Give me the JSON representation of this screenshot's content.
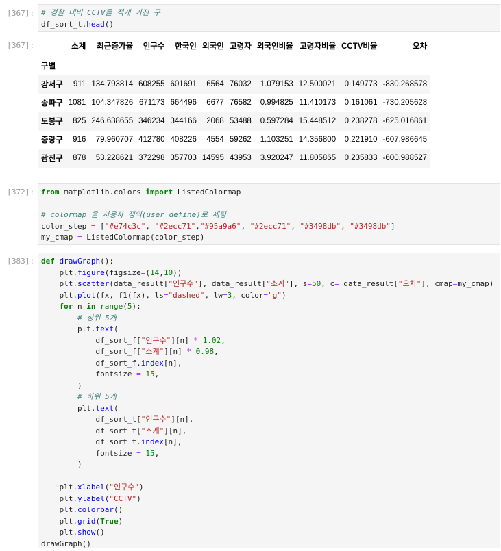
{
  "cells": [
    {
      "prompt": "[367]:",
      "lines": [
        [
          {
            "t": "# 경찰 대비 CCTV를 적게 가진 구",
            "c": "cm"
          }
        ],
        [
          {
            "t": "df_sort_t."
          },
          {
            "t": "head",
            "c": "fn"
          },
          {
            "t": "()"
          }
        ]
      ]
    },
    {
      "prompt": "[372]:",
      "lines": [
        [
          {
            "t": "from",
            "c": "kw"
          },
          {
            "t": " matplotlib.colors "
          },
          {
            "t": "import",
            "c": "kw"
          },
          {
            "t": " ListedColormap"
          }
        ],
        [
          {
            "t": ""
          }
        ],
        [
          {
            "t": "# colormap 을 사용자 정의(user define)로 세팅",
            "c": "cm"
          }
        ],
        [
          {
            "t": "color_step "
          },
          {
            "t": "=",
            "c": "op"
          },
          {
            "t": " ["
          },
          {
            "t": "\"#e74c3c\"",
            "c": "st"
          },
          {
            "t": ", "
          },
          {
            "t": "\"#2ecc71\"",
            "c": "st"
          },
          {
            "t": ","
          },
          {
            "t": "\"#95a9a6\"",
            "c": "st"
          },
          {
            "t": ", "
          },
          {
            "t": "\"#2ecc71\"",
            "c": "st"
          },
          {
            "t": ", "
          },
          {
            "t": "\"#3498db\"",
            "c": "st"
          },
          {
            "t": ", "
          },
          {
            "t": "\"#3498db\"",
            "c": "st"
          },
          {
            "t": "]"
          }
        ],
        [
          {
            "t": "my_cmap "
          },
          {
            "t": "=",
            "c": "op"
          },
          {
            "t": " ListedColormap(color_step)"
          }
        ]
      ]
    },
    {
      "prompt": "[383]:",
      "lines": [
        [
          {
            "t": "def",
            "c": "kw"
          },
          {
            "t": " "
          },
          {
            "t": "drawGraph",
            "c": "fn"
          },
          {
            "t": "():"
          }
        ],
        [
          {
            "t": "    plt."
          },
          {
            "t": "figure",
            "c": "fn"
          },
          {
            "t": "(figsize"
          },
          {
            "t": "=",
            "c": "op"
          },
          {
            "t": "("
          },
          {
            "t": "14",
            "c": "nm"
          },
          {
            "t": ","
          },
          {
            "t": "10",
            "c": "nm"
          },
          {
            "t": "))"
          }
        ],
        [
          {
            "t": "    plt."
          },
          {
            "t": "scatter",
            "c": "fn"
          },
          {
            "t": "(data_result["
          },
          {
            "t": "\"인구수\"",
            "c": "st"
          },
          {
            "t": "], data_result["
          },
          {
            "t": "\"소계\"",
            "c": "st"
          },
          {
            "t": "], s"
          },
          {
            "t": "=",
            "c": "op"
          },
          {
            "t": "50",
            "c": "nm"
          },
          {
            "t": ", c"
          },
          {
            "t": "=",
            "c": "op"
          },
          {
            "t": " data_result["
          },
          {
            "t": "\"오차\"",
            "c": "st"
          },
          {
            "t": "], cmap"
          },
          {
            "t": "=",
            "c": "op"
          },
          {
            "t": "my_cmap)"
          }
        ],
        [
          {
            "t": "    plt."
          },
          {
            "t": "plot",
            "c": "fn"
          },
          {
            "t": "(fx, f1(fx), ls"
          },
          {
            "t": "=",
            "c": "op"
          },
          {
            "t": "\"dashed\"",
            "c": "st"
          },
          {
            "t": ", lw"
          },
          {
            "t": "=",
            "c": "op"
          },
          {
            "t": "3",
            "c": "nm"
          },
          {
            "t": ", color"
          },
          {
            "t": "=",
            "c": "op"
          },
          {
            "t": "\"g\"",
            "c": "st"
          },
          {
            "t": ")"
          }
        ],
        [
          {
            "t": "    "
          },
          {
            "t": "for",
            "c": "kw"
          },
          {
            "t": " n "
          },
          {
            "t": "in",
            "c": "kw"
          },
          {
            "t": " "
          },
          {
            "t": "range",
            "c": "nm"
          },
          {
            "t": "("
          },
          {
            "t": "5",
            "c": "nm"
          },
          {
            "t": "):"
          }
        ],
        [
          {
            "t": "        "
          },
          {
            "t": "# 상위 5개",
            "c": "cm"
          }
        ],
        [
          {
            "t": "        plt."
          },
          {
            "t": "text",
            "c": "fn"
          },
          {
            "t": "("
          }
        ],
        [
          {
            "t": "            df_sort_f["
          },
          {
            "t": "\"인구수\"",
            "c": "st"
          },
          {
            "t": "][n] "
          },
          {
            "t": "*",
            "c": "op"
          },
          {
            "t": " "
          },
          {
            "t": "1.02",
            "c": "nm"
          },
          {
            "t": ","
          }
        ],
        [
          {
            "t": "            df_sort_f["
          },
          {
            "t": "\"소계\"",
            "c": "st"
          },
          {
            "t": "][n] "
          },
          {
            "t": "*",
            "c": "op"
          },
          {
            "t": " "
          },
          {
            "t": "0.98",
            "c": "nm"
          },
          {
            "t": ","
          }
        ],
        [
          {
            "t": "            df_sort_f."
          },
          {
            "t": "index",
            "c": "fn"
          },
          {
            "t": "[n],"
          }
        ],
        [
          {
            "t": "            fontsize "
          },
          {
            "t": "=",
            "c": "op"
          },
          {
            "t": " "
          },
          {
            "t": "15",
            "c": "nm"
          },
          {
            "t": ","
          }
        ],
        [
          {
            "t": "        )"
          }
        ],
        [
          {
            "t": "        "
          },
          {
            "t": "# 하위 5개",
            "c": "cm"
          }
        ],
        [
          {
            "t": "        plt."
          },
          {
            "t": "text",
            "c": "fn"
          },
          {
            "t": "("
          }
        ],
        [
          {
            "t": "            df_sort_t["
          },
          {
            "t": "\"인구수\"",
            "c": "st"
          },
          {
            "t": "][n],"
          }
        ],
        [
          {
            "t": "            df_sort_t["
          },
          {
            "t": "\"소계\"",
            "c": "st"
          },
          {
            "t": "][n],"
          }
        ],
        [
          {
            "t": "            df_sort_t."
          },
          {
            "t": "index",
            "c": "fn"
          },
          {
            "t": "[n],"
          }
        ],
        [
          {
            "t": "            fontsize "
          },
          {
            "t": "=",
            "c": "op"
          },
          {
            "t": " "
          },
          {
            "t": "15",
            "c": "nm"
          },
          {
            "t": ","
          }
        ],
        [
          {
            "t": "        )"
          }
        ],
        [
          {
            "t": ""
          }
        ],
        [
          {
            "t": "    plt."
          },
          {
            "t": "xlabel",
            "c": "fn"
          },
          {
            "t": "("
          },
          {
            "t": "\"인구수\"",
            "c": "st"
          },
          {
            "t": ")"
          }
        ],
        [
          {
            "t": "    plt."
          },
          {
            "t": "ylabel",
            "c": "fn"
          },
          {
            "t": "("
          },
          {
            "t": "\"CCTV\"",
            "c": "st"
          },
          {
            "t": ")"
          }
        ],
        [
          {
            "t": "    plt."
          },
          {
            "t": "colorbar",
            "c": "fn"
          },
          {
            "t": "()"
          }
        ],
        [
          {
            "t": "    plt."
          },
          {
            "t": "grid",
            "c": "fn"
          },
          {
            "t": "("
          },
          {
            "t": "True",
            "c": "kw"
          },
          {
            "t": ")"
          }
        ],
        [
          {
            "t": "    plt."
          },
          {
            "t": "show",
            "c": "fn"
          },
          {
            "t": "()"
          }
        ],
        [
          {
            "t": "drawGraph()"
          }
        ]
      ]
    }
  ],
  "output": {
    "prompt": "[367]:",
    "index_name": "구별",
    "columns": [
      "소계",
      "최근증가율",
      "인구수",
      "한국인",
      "외국인",
      "고령자",
      "외국인비율",
      "고령자비율",
      "CCTV비율",
      "오차"
    ],
    "rows": [
      {
        "index": "강서구",
        "values": [
          "911",
          "134.793814",
          "608255",
          "601691",
          "6564",
          "76032",
          "1.079153",
          "12.500021",
          "0.149773",
          "-830.268578"
        ]
      },
      {
        "index": "송파구",
        "values": [
          "1081",
          "104.347826",
          "671173",
          "664496",
          "6677",
          "76582",
          "0.994825",
          "11.410173",
          "0.161061",
          "-730.205628"
        ]
      },
      {
        "index": "도봉구",
        "values": [
          "825",
          "246.638655",
          "346234",
          "344166",
          "2068",
          "53488",
          "0.597284",
          "15.448512",
          "0.238278",
          "-625.016861"
        ]
      },
      {
        "index": "중랑구",
        "values": [
          "916",
          "79.960707",
          "412780",
          "408226",
          "4554",
          "59262",
          "1.103251",
          "14.356800",
          "0.221910",
          "-607.986645"
        ]
      },
      {
        "index": "광진구",
        "values": [
          "878",
          "53.228621",
          "372298",
          "357703",
          "14595",
          "43953",
          "3.920247",
          "11.805865",
          "0.235833",
          "-600.988527"
        ]
      }
    ]
  }
}
